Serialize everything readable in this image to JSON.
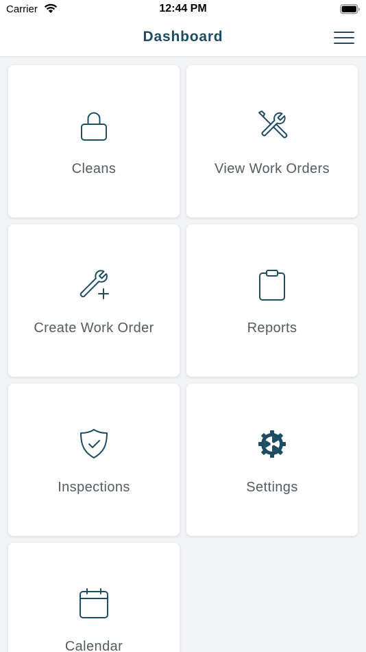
{
  "status_bar": {
    "carrier": "Carrier",
    "time": "12:44 PM"
  },
  "nav": {
    "title": "Dashboard"
  },
  "colors": {
    "accent": "#1d4c63",
    "label": "#545b61",
    "background": "#f2f3f4",
    "tile": "#ffffff"
  },
  "tiles": [
    {
      "label": "Cleans",
      "icon": "lock-icon"
    },
    {
      "label": "View Work Orders",
      "icon": "tools-icon"
    },
    {
      "label": "Create Work Order",
      "icon": "wrench-plus-icon"
    },
    {
      "label": "Reports",
      "icon": "clipboard-icon"
    },
    {
      "label": "Inspections",
      "icon": "shield-check-icon"
    },
    {
      "label": "Settings",
      "icon": "gear-icon"
    },
    {
      "label": "Calendar",
      "icon": "calendar-icon"
    }
  ]
}
